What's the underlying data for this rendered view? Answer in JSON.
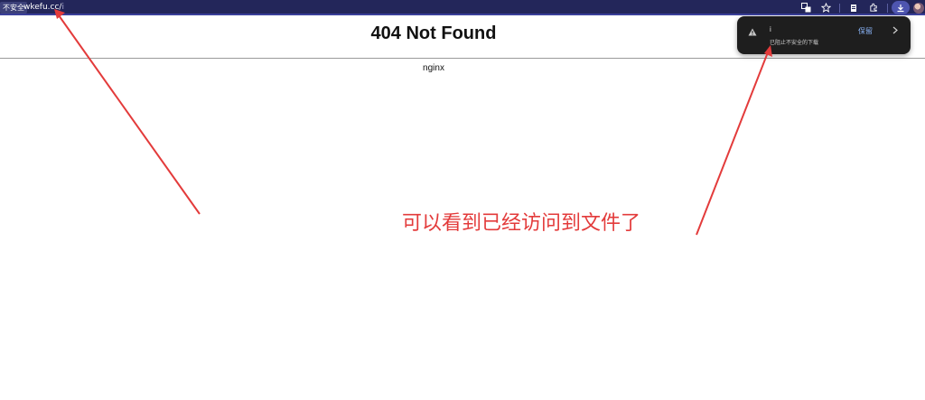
{
  "browser": {
    "security_label": "不安全",
    "url_host": "wkefu.cc/",
    "url_path": "i"
  },
  "page": {
    "title": "404 Not Found",
    "server": "nginx"
  },
  "download_popup": {
    "filename": "i",
    "status": "已阻止不安全的下载",
    "keep_label": "保留"
  },
  "annotation": {
    "text": "可以看到已经访问到文件了",
    "color": "#e33b3b"
  },
  "colors": {
    "topbar": "#23265a",
    "popup_bg": "#1e1e1e",
    "link_blue": "#8ab4f8"
  }
}
